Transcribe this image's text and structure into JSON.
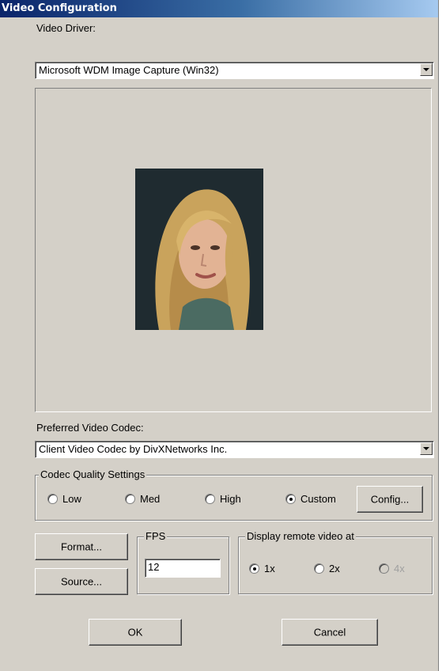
{
  "title": "Video Configuration",
  "video_driver": {
    "label": "Video Driver:",
    "value": "Microsoft WDM Image Capture (Win32)"
  },
  "preview": {
    "content": "webcam-preview-face"
  },
  "codec": {
    "label": "Preferred Video Codec:",
    "value": "Client Video Codec by DivXNetworks Inc."
  },
  "quality": {
    "title": "Codec Quality Settings",
    "options": [
      "Low",
      "Med",
      "High",
      "Custom"
    ],
    "selected": "Custom",
    "config_label": "Config..."
  },
  "buttons": {
    "format": "Format...",
    "source": "Source...",
    "ok": "OK",
    "cancel": "Cancel"
  },
  "fps": {
    "title": "FPS",
    "value": "12"
  },
  "display": {
    "title": "Display remote video at",
    "options": [
      "1x",
      "2x",
      "4x"
    ],
    "selected": "1x",
    "disabled": [
      "4x"
    ]
  },
  "colors": {
    "title_bar": "#0a246a",
    "dialog_bg": "#d4d0c8"
  }
}
